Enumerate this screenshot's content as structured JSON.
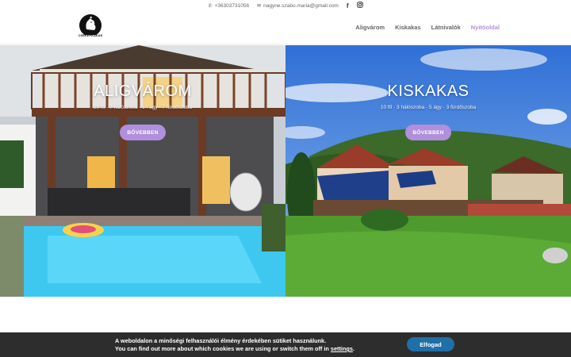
{
  "topbar": {
    "phone": "+36303731056",
    "email": "nagyne.szabo.maria@gmail.com",
    "social": [
      "facebook-icon",
      "instagram-icon"
    ]
  },
  "header": {
    "logo_text": "CSEKÉPKAKAS",
    "nav": [
      {
        "label": "Aligvárom",
        "active": false
      },
      {
        "label": "Kiskakas",
        "active": false
      },
      {
        "label": "Látnivalók",
        "active": false
      },
      {
        "label": "Nyitóoldal",
        "active": true
      }
    ]
  },
  "hero": {
    "left": {
      "title": "ALIGVÁROM",
      "subtitle": "20 fő · 7 hálószoba · 14 ágy · 7 fürdőszoba",
      "button": "BŐVEBBEN"
    },
    "right": {
      "title": "KISKAKAS",
      "subtitle": "10 fő · 3 hálószoba · 5 ágy · 3 fürdőszoba",
      "button": "BŐVEBBEN"
    }
  },
  "cookie": {
    "line1": "A weboldalon a minőségi felhasználói élmény érdekében sütiket használunk.",
    "line2_prefix": "You can find out more about which cookies we are using or switch them off in ",
    "line2_link": "settings",
    "line2_suffix": ".",
    "accept": "Elfogad"
  },
  "colors": {
    "accent": "#b08fdc",
    "cookie_bg": "#2d2d2d",
    "cookie_button": "#1f6fa8"
  }
}
